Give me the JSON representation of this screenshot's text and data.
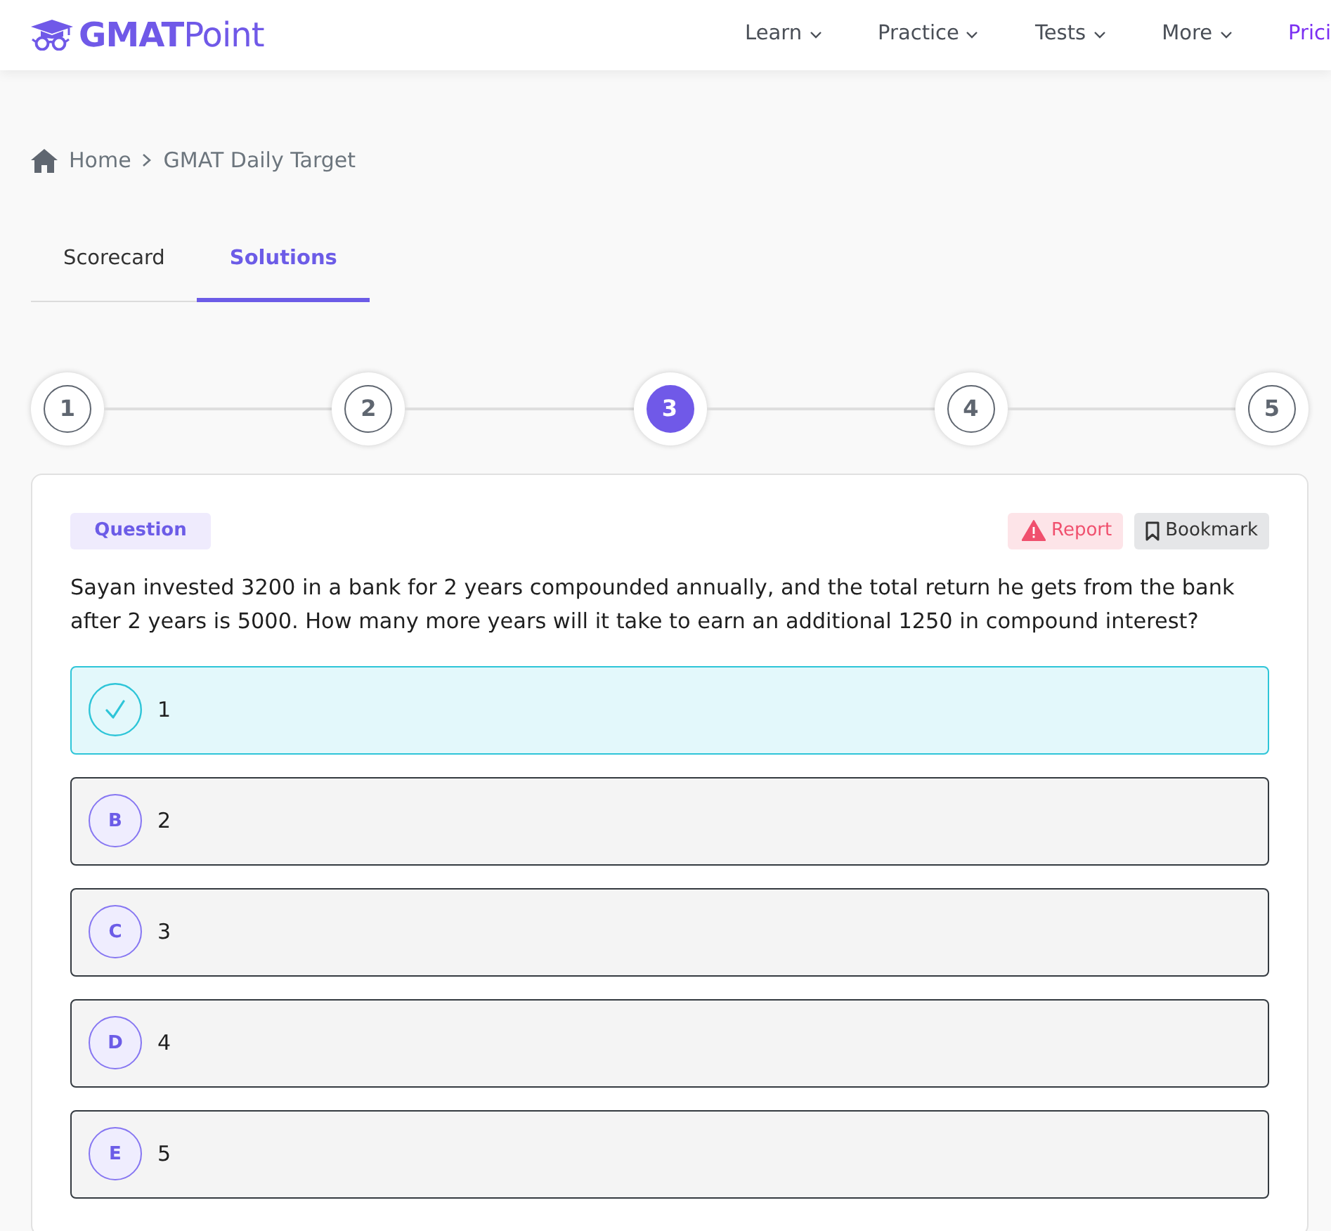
{
  "header": {
    "logo": "**GMAT**Point",
    "nav": [
      {
        "label": "Learn",
        "kind": "dropdown"
      },
      {
        "label": "Practice",
        "kind": "dropdown"
      },
      {
        "label": "Tests",
        "kind": "dropdown"
      },
      {
        "label": "More",
        "kind": "dropdown"
      },
      {
        "label": "Prici",
        "kind": "highlight"
      }
    ]
  },
  "breadcrumb": [
    "Home",
    "GMAT Daily Target"
  ],
  "tabs": [
    {
      "label": "Scorecard",
      "selected": false
    },
    {
      "label": "Solutions",
      "selected": true
    }
  ],
  "steps": [
    {
      "label": "1",
      "selected": false
    },
    {
      "label": "2",
      "selected": false
    },
    {
      "label": "3",
      "selected": true
    },
    {
      "label": "4",
      "selected": false
    },
    {
      "label": "5",
      "selected": false
    }
  ],
  "question": {
    "badge": "Question",
    "actions": [
      {
        "label": "Report",
        "kind": "report"
      },
      {
        "label": "Bookmark",
        "kind": "bookmark"
      }
    ],
    "text": "Sayan invested 3200 in a bank for 2 years compounded annually, and the total return he gets from the bank after 2 years is 5000. How many more years will it take to earn an additional 1250 in compound interest?",
    "options": [
      {
        "text": "1",
        "correct": true
      },
      {
        "letter": "B",
        "text": "2",
        "correct": false
      },
      {
        "letter": "C",
        "text": "3",
        "correct": false
      },
      {
        "letter": "D",
        "text": "4",
        "correct": false
      },
      {
        "letter": "E",
        "text": "5",
        "correct": false
      }
    ]
  }
}
